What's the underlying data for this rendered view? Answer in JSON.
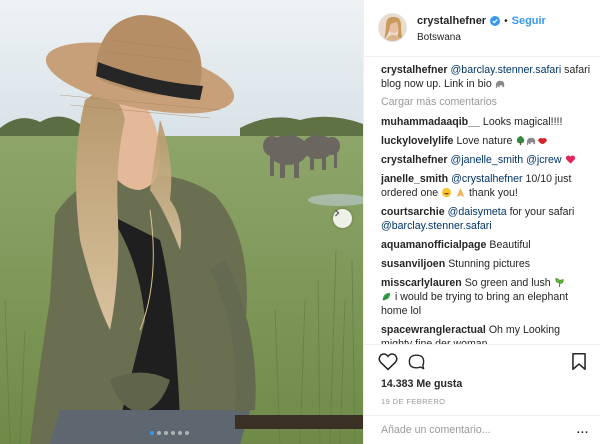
{
  "post": {
    "username": "crystalhefner",
    "separator": "•",
    "follow_label": "Seguir",
    "location": "Botswana",
    "likes": "14.383 Me gusta",
    "date": "19 DE FEBRERO",
    "comment_placeholder": "Añade un comentario...",
    "more_label": "...",
    "carousel": {
      "total": 6,
      "active_index": 0
    }
  },
  "caption": {
    "user": "crystalhefner",
    "mention": "@barclay.stenner.safari",
    "text": " safari blog now up. Link in bio "
  },
  "load_more_label": "Cargar más comentarios",
  "comments": [
    {
      "user": "muhammadaaqib__",
      "text": "Looks magical!!!!"
    },
    {
      "user": "luckylovelylife",
      "text": "Love nature "
    },
    {
      "user": "crystalhefner",
      "mention1": "@janelle_smith",
      "mention2": "@jcrew",
      "text": " "
    },
    {
      "user": "janelle_smith",
      "mention": "@crystalhefner",
      "text1": " 10/10 just ordered one ",
      "text2": " thank you!"
    },
    {
      "user": "courtsarchie",
      "mention": "@daisymeta",
      "text1": " for your safari ",
      "mention2": "@barclay.stenner.safari"
    },
    {
      "user": "aquamanofficialpage",
      "text": "Beautiful"
    },
    {
      "user": "susanviljoen",
      "text": "Stunning pictures"
    },
    {
      "user": "misscarlylauren",
      "text1": "So green and lush ",
      "text2": " i would be trying to bring an elephant home lol"
    },
    {
      "user": "spacewrangleractual",
      "text": "Oh my Looking mighty fine der woman"
    }
  ],
  "colors": {
    "link": "#003569",
    "follow": "#3897f0",
    "muted": "#999999",
    "text": "#262626"
  },
  "icons": [
    "verified-icon",
    "heart-icon",
    "comment-icon",
    "bookmark-icon",
    "chevron-right-icon",
    "elephant-emoji",
    "heart-emoji",
    "tree-emoji",
    "laugh-emoji",
    "pray-emoji",
    "leaf-emoji",
    "sprout-emoji",
    "lips-emoji"
  ]
}
